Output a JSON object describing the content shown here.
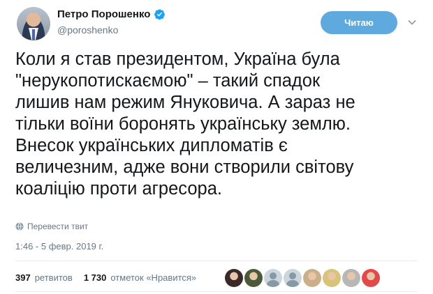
{
  "profile": {
    "display_name": "Петро Порошенко",
    "handle": "@poroshenko"
  },
  "follow_button": {
    "label": "Читаю"
  },
  "tweet": {
    "text": "Коли я став президентом, Україна була\n\"нерукопотискаємою\" – такий спадок\nлишив нам режим Януковича. А зараз не\nтільки воїни боронять українську землю.\nВнесок українських дипломатів є\nвеличезним, адже вони створили світову\nкоаліцію проти агресора.",
    "translate_label": "Перевести твит",
    "timestamp": "1:46 - 5 февр. 2019 г."
  },
  "stats": {
    "retweets_count": "397",
    "retweets_label": "ретвитов",
    "likes_count": "1 730",
    "likes_label": "отметок «Нравится»"
  },
  "likers": [
    {
      "color": "#3a2a2a"
    },
    {
      "color": "#4b5a3a"
    },
    {
      "color": "default"
    },
    {
      "color": "default"
    },
    {
      "color": "#c9b08a"
    },
    {
      "color": "#d9c27a"
    },
    {
      "color": "#b7b7b7"
    },
    {
      "color": "#e04a4a"
    }
  ],
  "colors": {
    "accent": "#5ea9dd",
    "verified": "#1da1f2",
    "secondary_text": "#657786"
  }
}
